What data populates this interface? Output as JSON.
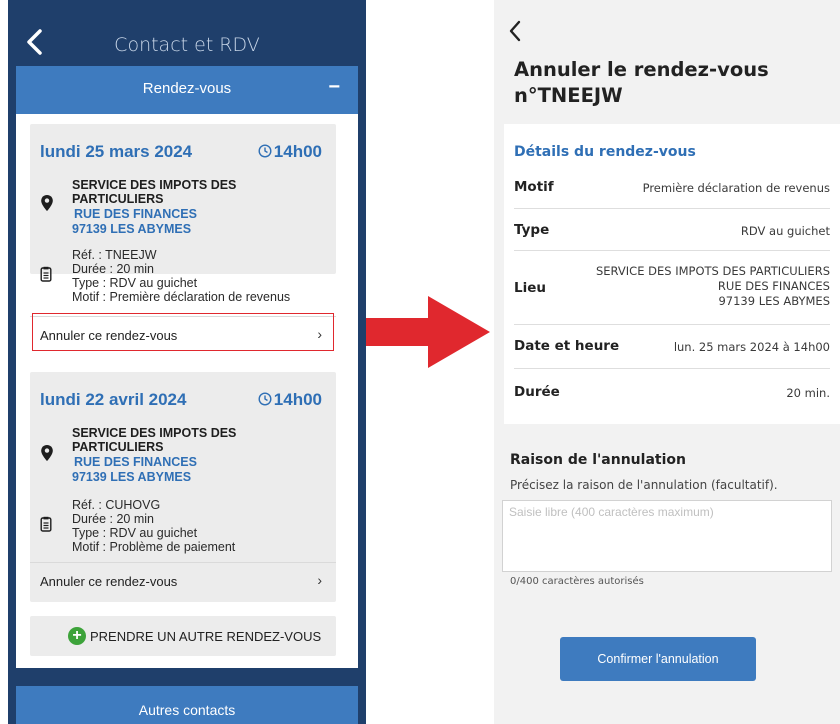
{
  "left": {
    "title": "Contact et RDV",
    "section_label": "Rendez-vous",
    "section_toggle": "−",
    "appointments": [
      {
        "date": "lundi 25 mars 2024",
        "time": "14h00",
        "service": "SERVICE DES IMPOTS DES PARTICULIERS",
        "street": "RUE DES FINANCES",
        "city": "97139 LES ABYMES",
        "ref": "Réf. : TNEEJW",
        "duration": "Durée : 20 min",
        "type": "Type : RDV au guichet",
        "motif": "Motif : Première déclaration de revenus",
        "cancel_label": "Annuler ce rendez-vous"
      },
      {
        "date": "lundi 22 avril 2024",
        "time": "14h00",
        "service": "SERVICE DES IMPOTS DES PARTICULIERS",
        "street": "RUE DES FINANCES",
        "city": "97139 LES ABYMES",
        "ref": "Réf. : CUHOVG",
        "duration": "Durée : 20 min",
        "type": "Type : RDV au guichet",
        "motif": "Motif : Problème de paiement",
        "cancel_label": "Annuler ce rendez-vous"
      }
    ],
    "new_appointment_label": "PRENDRE UN AUTRE RENDEZ-VOUS",
    "bottom_section_label": "Autres contacts"
  },
  "right": {
    "title_line1": "Annuler le rendez-vous",
    "title_line2": "n°TNEEJW",
    "details_title": "Détails du rendez-vous",
    "details": {
      "motif_label": "Motif",
      "motif_value": "Première déclaration de revenus",
      "type_label": "Type",
      "type_value": "RDV au guichet",
      "lieu_label": "Lieu",
      "lieu_line1": "SERVICE DES IMPOTS DES PARTICULIERS",
      "lieu_line2": "RUE DES FINANCES",
      "lieu_line3": "97139 LES ABYMES",
      "datetime_label": "Date et heure",
      "datetime_value": "lun. 25 mars 2024 à 14h00",
      "duree_label": "Durée",
      "duree_value": "20 min."
    },
    "reason_title": "Raison de l'annulation",
    "reason_hint": "Précisez la raison de l'annulation (facultatif).",
    "reason_placeholder": "Saisie libre (400 caractères maximum)",
    "reason_value": "",
    "counter": "0/400 caractères autorisés",
    "confirm_label": "Confirmer l'annulation"
  },
  "colors": {
    "navy_bg": "#1f3f6b",
    "accent_blue": "#3e7bbf",
    "link_blue": "#2f6fb5",
    "highlight_red": "#e0282e",
    "add_green": "#3da33a"
  },
  "icons": [
    "chevron-left-icon",
    "clock-icon",
    "location-pin-icon",
    "document-icon",
    "chevron-right-icon",
    "plus-circle-icon",
    "red-arrow"
  ]
}
